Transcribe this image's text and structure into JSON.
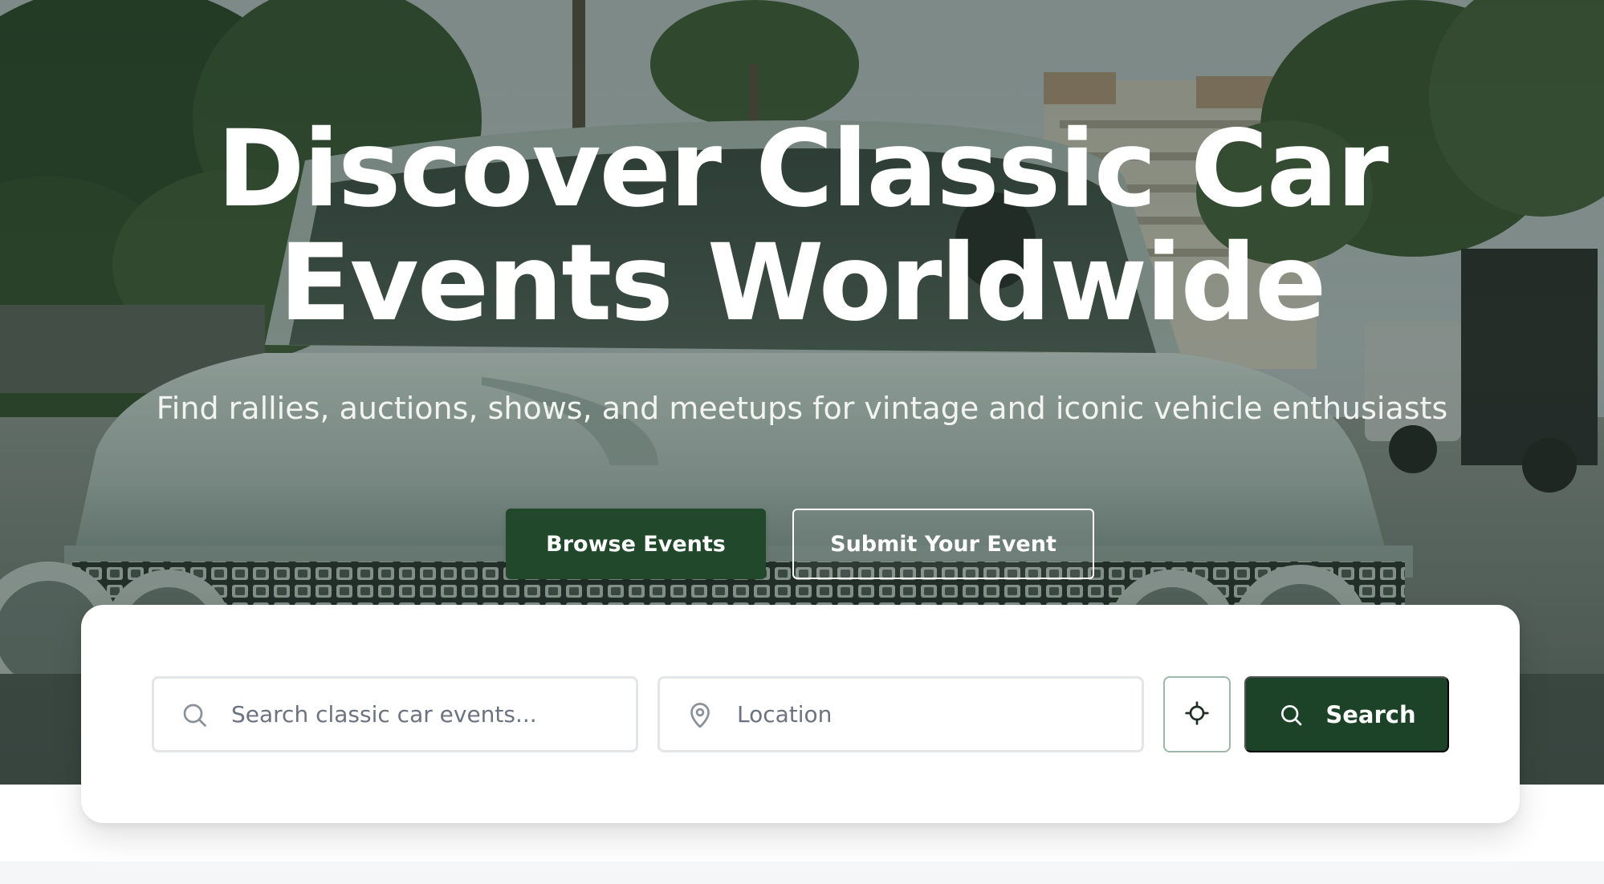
{
  "hero": {
    "title_line1": "Discover Classic Car",
    "title_line2": "Events Worldwide",
    "subtitle": "Find rallies, auctions, shows, and meetups for vintage and iconic vehicle enthusiasts",
    "browse_label": "Browse Events",
    "submit_label": "Submit Your Event",
    "background": "vintage-car-photo"
  },
  "search": {
    "query_placeholder": "Search classic car events...",
    "query_value": "",
    "location_placeholder": "Location",
    "location_value": "",
    "search_label": "Search",
    "icons": {
      "query": "search-icon",
      "location": "map-pin-icon",
      "locate": "crosshair-icon",
      "button": "search-icon"
    }
  },
  "colors": {
    "primary": "#21482b",
    "search_button": "#1c4227",
    "input_border": "#e3e6e8",
    "locate_border": "#9fb7aa"
  }
}
